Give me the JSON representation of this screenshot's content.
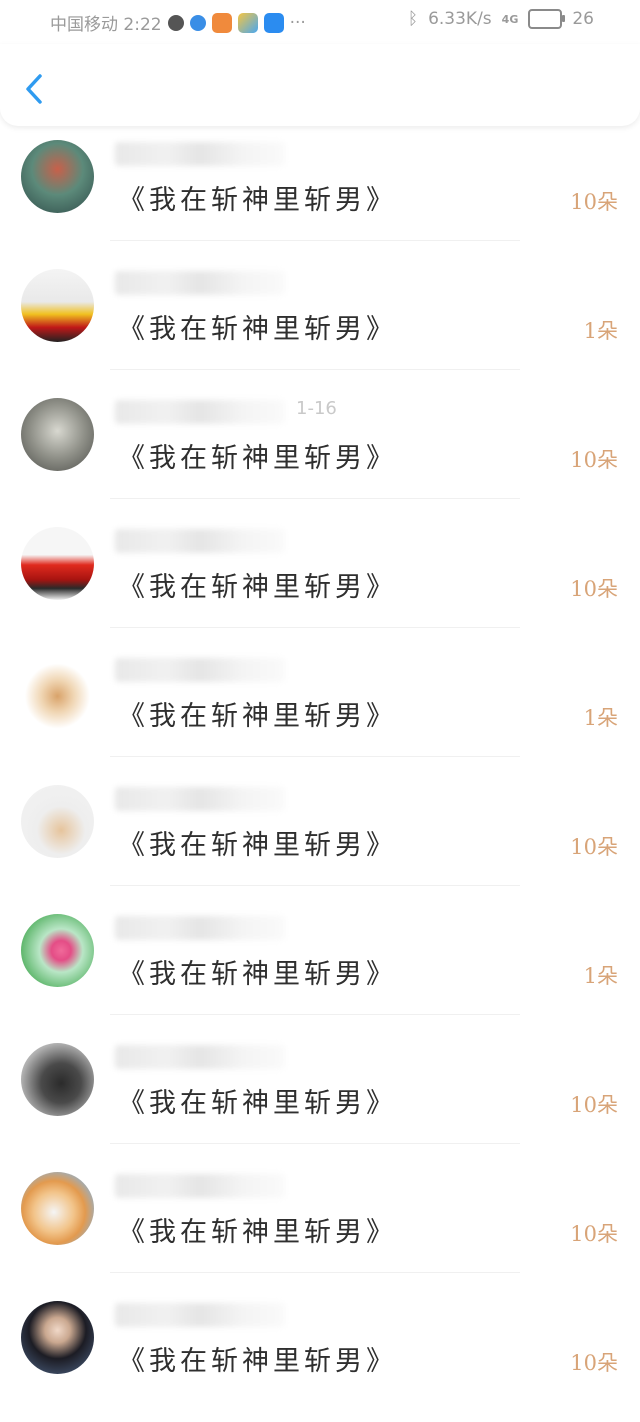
{
  "status_bar": {
    "carrier_time": "中国移动 2:22",
    "net_speed": "6.33K/s",
    "signal": "4G",
    "battery": "26"
  },
  "header": {
    "back_icon": "chevron-left-icon",
    "accent": "#2f9bf0"
  },
  "items": [
    {
      "gift": "《我在斩神里斩男》",
      "count": "10朵",
      "date": ""
    },
    {
      "gift": "《我在斩神里斩男》",
      "count": "1朵",
      "date": ""
    },
    {
      "gift": "《我在斩神里斩男》",
      "count": "10朵",
      "date": "1-16"
    },
    {
      "gift": "《我在斩神里斩男》",
      "count": "10朵",
      "date": ""
    },
    {
      "gift": "《我在斩神里斩男》",
      "count": "1朵",
      "date": ""
    },
    {
      "gift": "《我在斩神里斩男》",
      "count": "10朵",
      "date": ""
    },
    {
      "gift": "《我在斩神里斩男》",
      "count": "1朵",
      "date": ""
    },
    {
      "gift": "《我在斩神里斩男》",
      "count": "10朵",
      "date": ""
    },
    {
      "gift": "《我在斩神里斩男》",
      "count": "10朵",
      "date": ""
    },
    {
      "gift": "《我在斩神里斩男》",
      "count": "10朵",
      "date": ""
    }
  ],
  "colors": {
    "count": "#d8a478",
    "divider": "#f0f0f0"
  }
}
